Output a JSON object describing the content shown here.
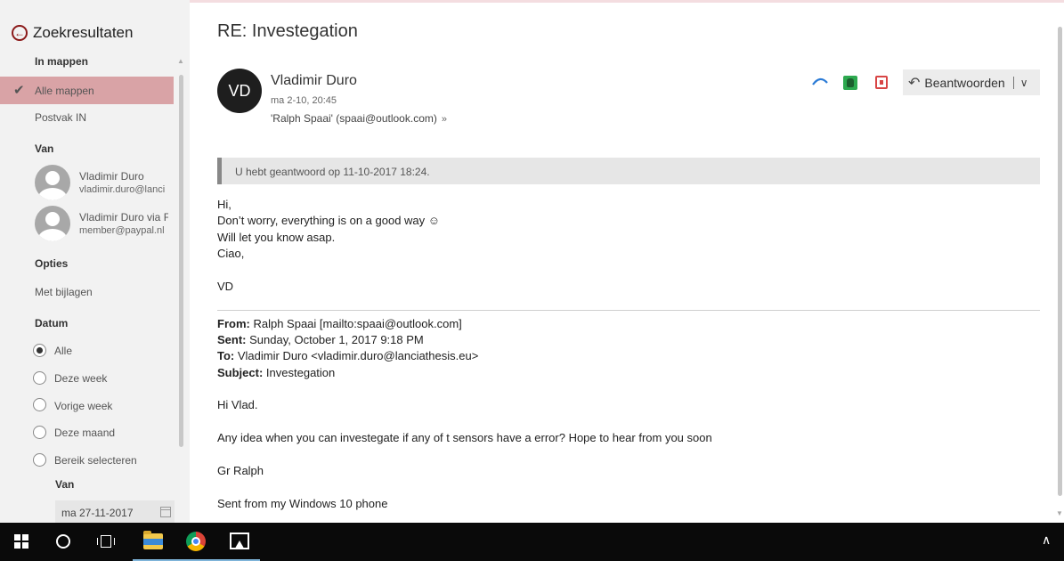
{
  "sidebar": {
    "back_title": "Zoekresultaten",
    "in_mappen_heading": "In mappen",
    "folders": [
      {
        "label": "Alle mappen",
        "selected": true
      },
      {
        "label": "Postvak IN",
        "selected": false
      }
    ],
    "van_heading": "Van",
    "senders": [
      {
        "name": "Vladimir Duro",
        "email": "vladimir.duro@lanci"
      },
      {
        "name": "Vladimir Duro via F",
        "email": "member@paypal.nl"
      }
    ],
    "opties_heading": "Opties",
    "met_bijlagen": "Met bijlagen",
    "datum_heading": "Datum",
    "date_options": [
      {
        "label": "Alle",
        "checked": true
      },
      {
        "label": "Deze week",
        "checked": false
      },
      {
        "label": "Vorige week",
        "checked": false
      },
      {
        "label": "Deze maand",
        "checked": false
      },
      {
        "label": "Bereik selecteren",
        "checked": false
      }
    ],
    "range_from_label": "Van",
    "range_from_value": "ma 27-11-2017"
  },
  "message": {
    "subject": "RE: Investegation",
    "avatar_initials": "VD",
    "from_name": "Vladimir Duro",
    "date": "ma 2-10, 20:45",
    "to": "'Ralph Spaai' (spaai@outlook.com)",
    "reply_button": "Beantwoorden",
    "notice": "U hebt geantwoord op 11-10-2017 18:24.",
    "body_lines": [
      "Hi,",
      "Don’t worry, everything is on a good way ☺",
      "Will let you know asap.",
      "Ciao,",
      "VD"
    ],
    "quoted": {
      "from_label": "From:",
      "from_value": "Ralph Spaai [mailto:spaai@outlook.com]",
      "sent_label": "Sent:",
      "sent_value": "Sunday, October 1, 2017 9:18 PM",
      "to_label": "To:",
      "to_value": "Vladimir Duro <vladimir.duro@lanciathesis.eu>",
      "subject_label": "Subject:",
      "subject_value": "Investegation",
      "lines": [
        "Hi Vlad.",
        "Any idea when you can investegate if any of t sensors have a error? Hope to hear from you soon",
        "Gr Ralph",
        "Sent from my Windows 10 phone"
      ]
    }
  },
  "icons": {
    "back": "back-arrow-icon",
    "check": "checkmark-icon",
    "reply": "reply-arrow-icon",
    "reply_dropdown": "chevron-down-icon"
  },
  "colors": {
    "selection": "#d9a3a6",
    "accent_dark_red": "#8b1a1a",
    "taskbar": "#0a0a0a"
  },
  "glyphs": {
    "back_arrow": "←",
    "check": "✔",
    "reply_arrow": "↶",
    "chevron": "∨",
    "expand": "»",
    "tray_up": "∧"
  }
}
